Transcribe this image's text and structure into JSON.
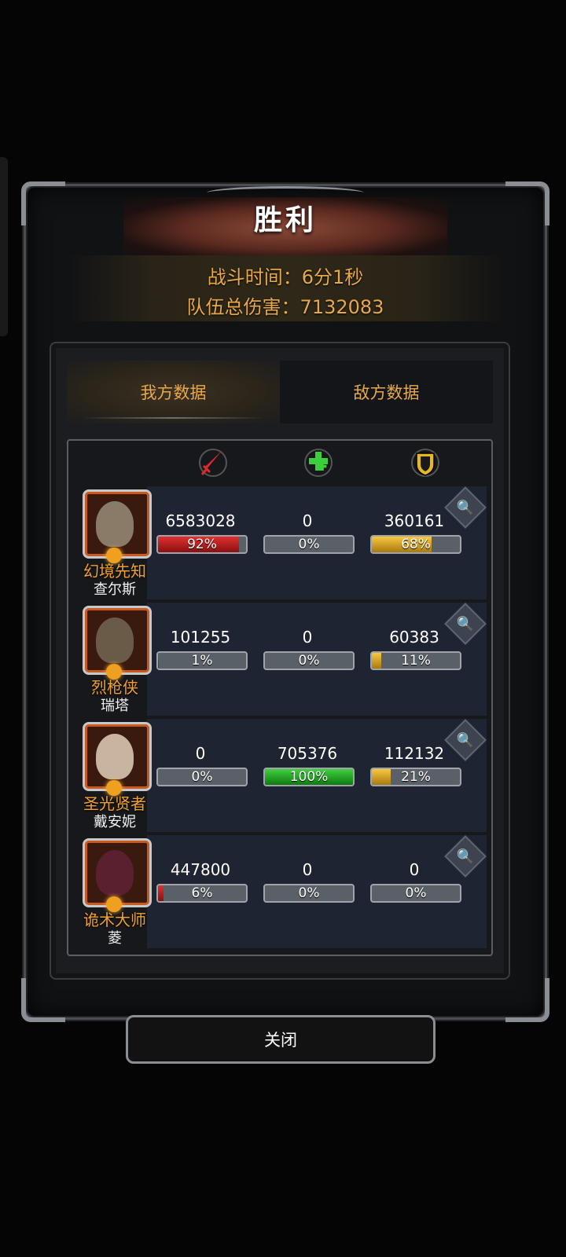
{
  "title": "胜利",
  "battle_time": "战斗时间：6分1秒",
  "team_damage": "队伍总伤害：7132083",
  "tabs": [
    {
      "label": "我方数据",
      "active": true
    },
    {
      "label": "敌方数据",
      "active": false
    }
  ],
  "columns": [
    {
      "icon": "sword-icon",
      "color": "#e02a2a"
    },
    {
      "icon": "heal-cross-icon",
      "color": "#3ccf3c"
    },
    {
      "icon": "shield-icon",
      "color": "#e8b820"
    }
  ],
  "heroes": [
    {
      "title": "幻境先知",
      "name": "查尔斯",
      "face": "#8a7a68",
      "damage": "6583028",
      "damage_pct": "92%",
      "damage_fill": 0.92,
      "heal": "0",
      "heal_pct": "0%",
      "heal_fill": 0,
      "tank": "360161",
      "tank_pct": "68%",
      "tank_fill": 0.68
    },
    {
      "title": "烈枪侠",
      "name": "瑞塔",
      "face": "#6a5a48",
      "damage": "101255",
      "damage_pct": "1%",
      "damage_fill": 0.01,
      "heal": "0",
      "heal_pct": "0%",
      "heal_fill": 0,
      "tank": "60383",
      "tank_pct": "11%",
      "tank_fill": 0.11
    },
    {
      "title": "圣光贤者",
      "name": "戴安妮",
      "face": "#c8b4a0",
      "damage": "0",
      "damage_pct": "0%",
      "damage_fill": 0,
      "heal": "705376",
      "heal_pct": "100%",
      "heal_fill": 1.0,
      "tank": "112132",
      "tank_pct": "21%",
      "tank_fill": 0.21
    },
    {
      "title": "诡术大师",
      "name": "菱",
      "face": "#5a2030",
      "damage": "447800",
      "damage_pct": "6%",
      "damage_fill": 0.06,
      "heal": "0",
      "heal_pct": "0%",
      "heal_fill": 0,
      "tank": "0",
      "tank_pct": "0%",
      "tank_fill": 0
    }
  ],
  "close_label": "关闭"
}
